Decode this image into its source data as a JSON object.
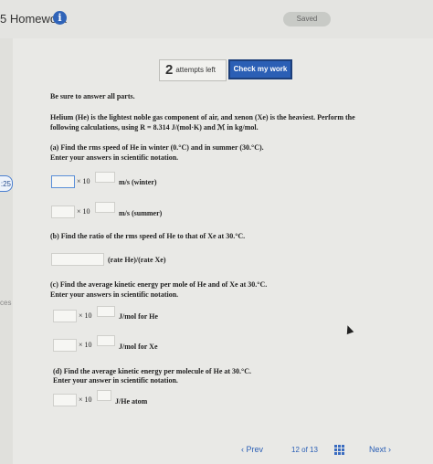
{
  "header": {
    "title": "5 Homework",
    "info_glyph": "i",
    "saved_label": "Saved"
  },
  "left_strip": {
    "timer": ":25",
    "tab_label": "ces"
  },
  "toolbar": {
    "attempts_count": "2",
    "attempts_label": "attempts left",
    "check_label": "Check my work"
  },
  "question": {
    "instructions": "Be sure to answer all parts.",
    "intro_line1": "Helium (He) is the lightest noble gas component of air, and xenon (Xe) is the heaviest. Perform the",
    "intro_line2": "following calculations, using R = 8.314 J/(mol·K) and ℳ in kg/mol.",
    "part_a_line1": "(a) Find the rms speed of He in winter (0.°C) and in summer (30.°C).",
    "part_a_line2": "Enter your answers in scientific notation.",
    "part_b": "(b) Find the ratio of the rms speed of He to that of Xe at 30.°C.",
    "part_c_line1": "(c) Find the average kinetic energy per mole of He and of Xe at 30.°C.",
    "part_c_line2": "Enter your answers in scientific notation.",
    "part_d_line1": "(d) Find the average kinetic energy per molecule of He at 30.°C.",
    "part_d_line2": "Enter your answer in scientific notation."
  },
  "answers": {
    "times_label": "× 10",
    "a_winter_unit": "m/s (winter)",
    "a_summer_unit": "m/s (summer)",
    "b_unit": "(rate He)/(rate Xe)",
    "c_he_unit": "J/mol for He",
    "c_xe_unit": "J/mol for Xe",
    "d_unit": "J/He atom"
  },
  "footer": {
    "prev_label": "‹  Prev",
    "page_current": "12",
    "page_of": "of",
    "page_total": "13",
    "next_label": "Next  ›"
  },
  "colors": {
    "accent": "#2b5fb5",
    "panel": "#e9e9e6"
  }
}
